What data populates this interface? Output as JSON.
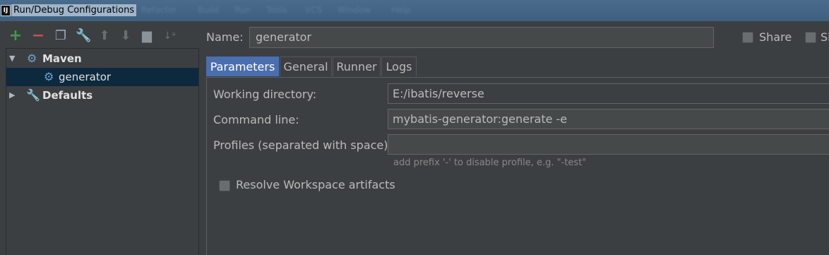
{
  "window": {
    "title": "Run/Debug Configurations",
    "background_menu": [
      "Refactor",
      "Build",
      "Run",
      "Tools",
      "VCS",
      "Window",
      "Help"
    ]
  },
  "toolbar": {
    "icons": [
      "add-icon",
      "remove-icon",
      "copy-icon",
      "edit-defaults-icon",
      "move-up-icon",
      "move-down-icon",
      "folder-icon",
      "sort-icon"
    ]
  },
  "tree": {
    "maven": "Maven",
    "generator": "generator",
    "defaults": "Defaults"
  },
  "form": {
    "name_label": "Name:",
    "name_value": "generator",
    "share_label": "Share",
    "single_instance_label": "Si"
  },
  "tabs": [
    "Parameters",
    "General",
    "Runner",
    "Logs"
  ],
  "parameters": {
    "working_directory_label": "Working directory:",
    "working_directory_value": "E:/ibatis/reverse",
    "command_line_label": "Command line:",
    "command_line_value": "mybatis-generator:generate -e",
    "profiles_label": "Profiles (separated with space):",
    "profiles_value": "",
    "profiles_hint": "add prefix '-' to disable profile, e.g. \"-test\"",
    "resolve_workspace_label": "Resolve Workspace artifacts"
  },
  "colors": {
    "background": "#3c3f41",
    "selection": "#0d293e",
    "active_tab": "#4b6eaf",
    "input_bg": "#45494a"
  }
}
